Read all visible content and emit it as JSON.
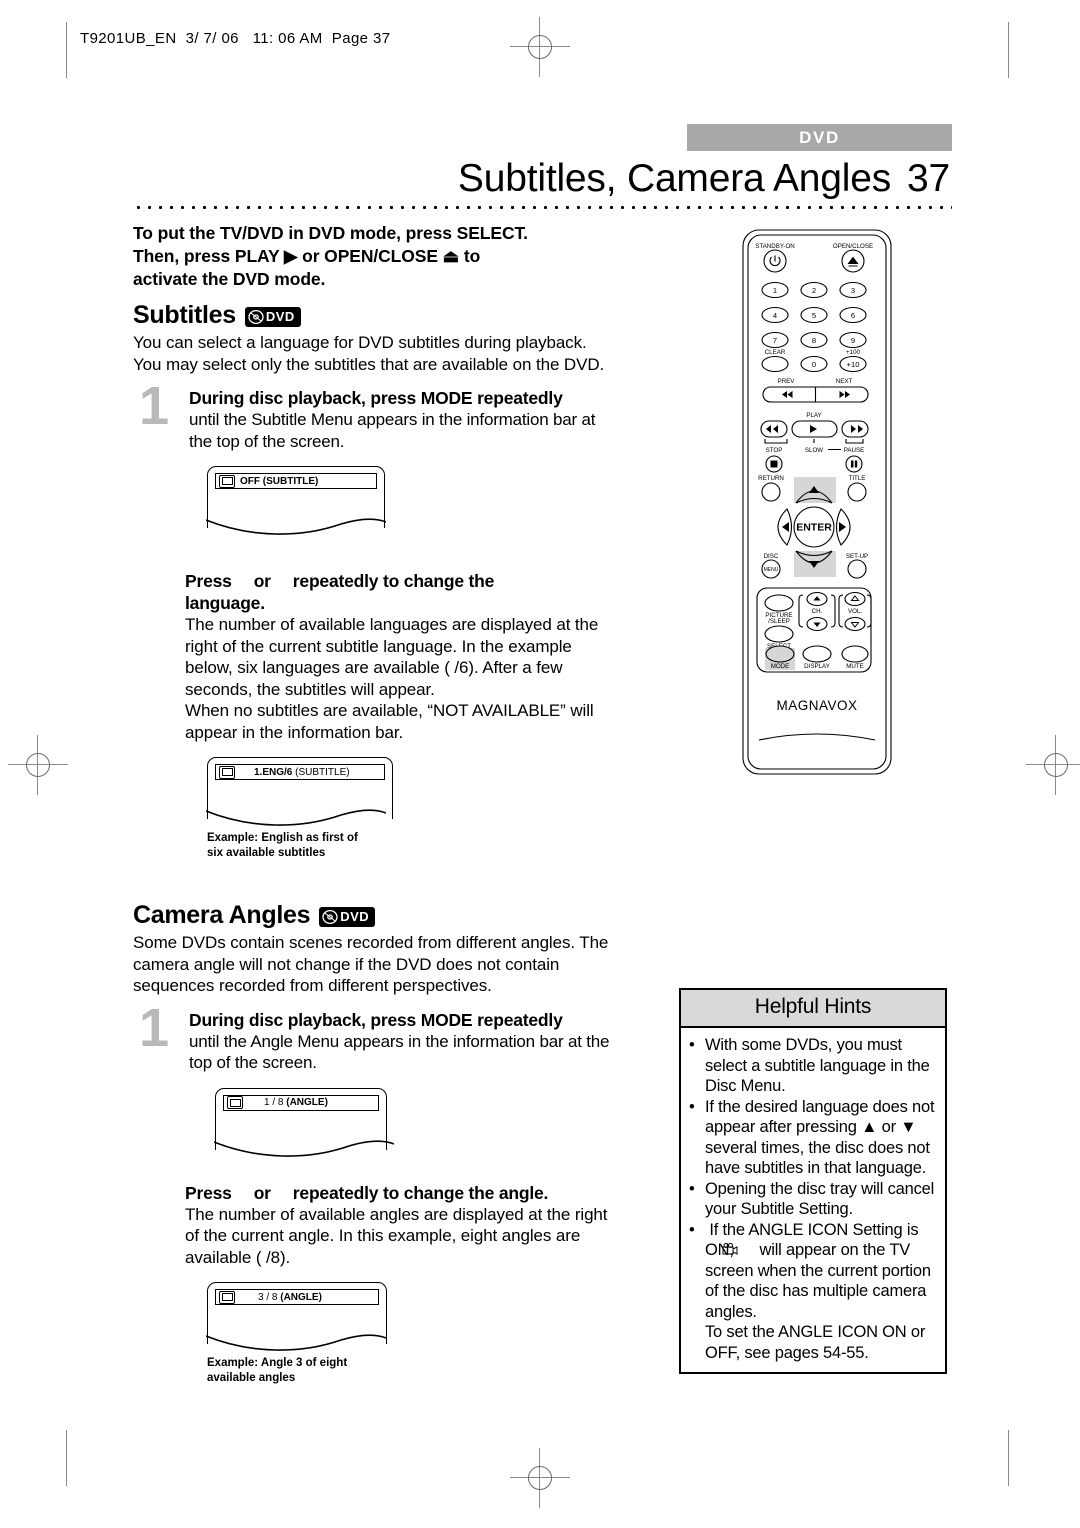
{
  "slug": "T9201UB_EN  3/ 7/ 06   11: 06 AM  Page 37",
  "header": {
    "tag": "DVD",
    "title": "Subtitles, Camera Angles",
    "page_number": "37"
  },
  "lead": {
    "line1": "To put the TV/DVD in DVD mode, press SELECT.",
    "line2": "Then, press PLAY ▶ or OPEN/CLOSE ⏏ to",
    "line3": "activate the DVD mode."
  },
  "subtitles": {
    "heading": "Subtitles",
    "badge": "DVD",
    "intro": "You can select a language for DVD subtitles during playback. You may select only the subtitles that are available on the DVD.",
    "step1": {
      "number": "1",
      "head": "During disc playback, press MODE repeatedly",
      "body": "until the Subtitle Menu appears in the information bar at the top of the screen."
    },
    "screen1": {
      "icon": "subtitle-icon",
      "text_bold": "OFF (SUBTITLE)"
    },
    "press": {
      "head_a": "Press",
      "head_or": "or",
      "head_b": "repeatedly to change the",
      "head_c": "language.",
      "body1": "The number of available languages are displayed at the right of the current subtitle language. In the example below, six languages are available (  /6). After a few seconds, the subtitles will appear.",
      "body2": "When no subtitles are available, “NOT AVAILABLE” will appear in the information bar."
    },
    "screen2": {
      "icon": "subtitle-icon",
      "text_bold": "1.ENG/6",
      "text_reg": "(SUBTITLE)"
    },
    "caption": {
      "line1": "Example: English as first of",
      "line2": "six available subtitles"
    }
  },
  "camera_angles": {
    "heading": "Camera Angles",
    "badge": "DVD",
    "intro": "Some DVDs contain scenes recorded from different angles. The camera angle will not change if the DVD does not contain sequences recorded from different perspectives.",
    "step1": {
      "number": "1",
      "head": "During disc playback, press MODE repeatedly",
      "body": "until the Angle Menu appears in the information bar at the top of the screen."
    },
    "screen1": {
      "icon": "angle-icon",
      "text_reg": "1 / 8",
      "text_bold": "(ANGLE)"
    },
    "press": {
      "head_a": "Press",
      "head_or": "or",
      "head_b": "repeatedly to change the angle.",
      "body1": "The number of available angles are displayed at the right of the current angle. In this example, eight angles are available (  /8)."
    },
    "screen2": {
      "icon": "angle-icon",
      "text_reg": "3 / 8",
      "text_bold": "(ANGLE)"
    },
    "caption": {
      "line1": "Example: Angle 3 of eight",
      "line2": "available angles"
    }
  },
  "hints": {
    "title": "Helpful Hints",
    "items": [
      "With some DVDs, you must select a subtitle language in the Disc Menu.",
      "If the desired language does not appear after pressing ▲ or ▼ several times, the disc does not have subtitles in that language.",
      "Opening the disc tray will cancel your Subtitle Setting."
    ],
    "angle_item": {
      "part1": "If the ANGLE ICON Setting is ON,",
      "part2": "will appear on the TV screen when the current portion of the disc has multiple camera angles.",
      "part3": "To set the ANGLE ICON ON or OFF, see pages 54-55."
    }
  },
  "remote": {
    "brand": "MAGNAVOX",
    "standby_label": "STANDBY-ON",
    "open_close_label": "OPEN/CLOSE",
    "keys": [
      "1",
      "2",
      "3",
      "4",
      "5",
      "6",
      "7",
      "8",
      "9",
      "0"
    ],
    "clear_label": "CLEAR",
    "plus100_label": "+100",
    "plus10_label": "+10",
    "prev_label": "PREV",
    "next_label": "NEXT",
    "play_label": "PLAY",
    "stop_label": "STOP",
    "slow_label": "SLOW",
    "pause_label": "PAUSE",
    "return_label": "RETURN",
    "title_label": "TITLE",
    "enter_label": "ENTER",
    "disc_label": "DISC",
    "menu_label": "MENU",
    "setup_label": "SET-UP",
    "picture_label": "PICTURE",
    "sleep_label": "/SLEEP",
    "ch_label": "CH.",
    "vol_label": "VOL.",
    "select_label": "SELECT",
    "mode_label": "MODE",
    "display_label": "DISPLAY",
    "mute_label": "MUTE"
  },
  "colors": {
    "tag_gray": "#a8a8a8",
    "step_num_gray": "#b9b9b9",
    "hint_header_gray": "#d9d9d9",
    "highlight_gray": "#d6d6d6"
  }
}
